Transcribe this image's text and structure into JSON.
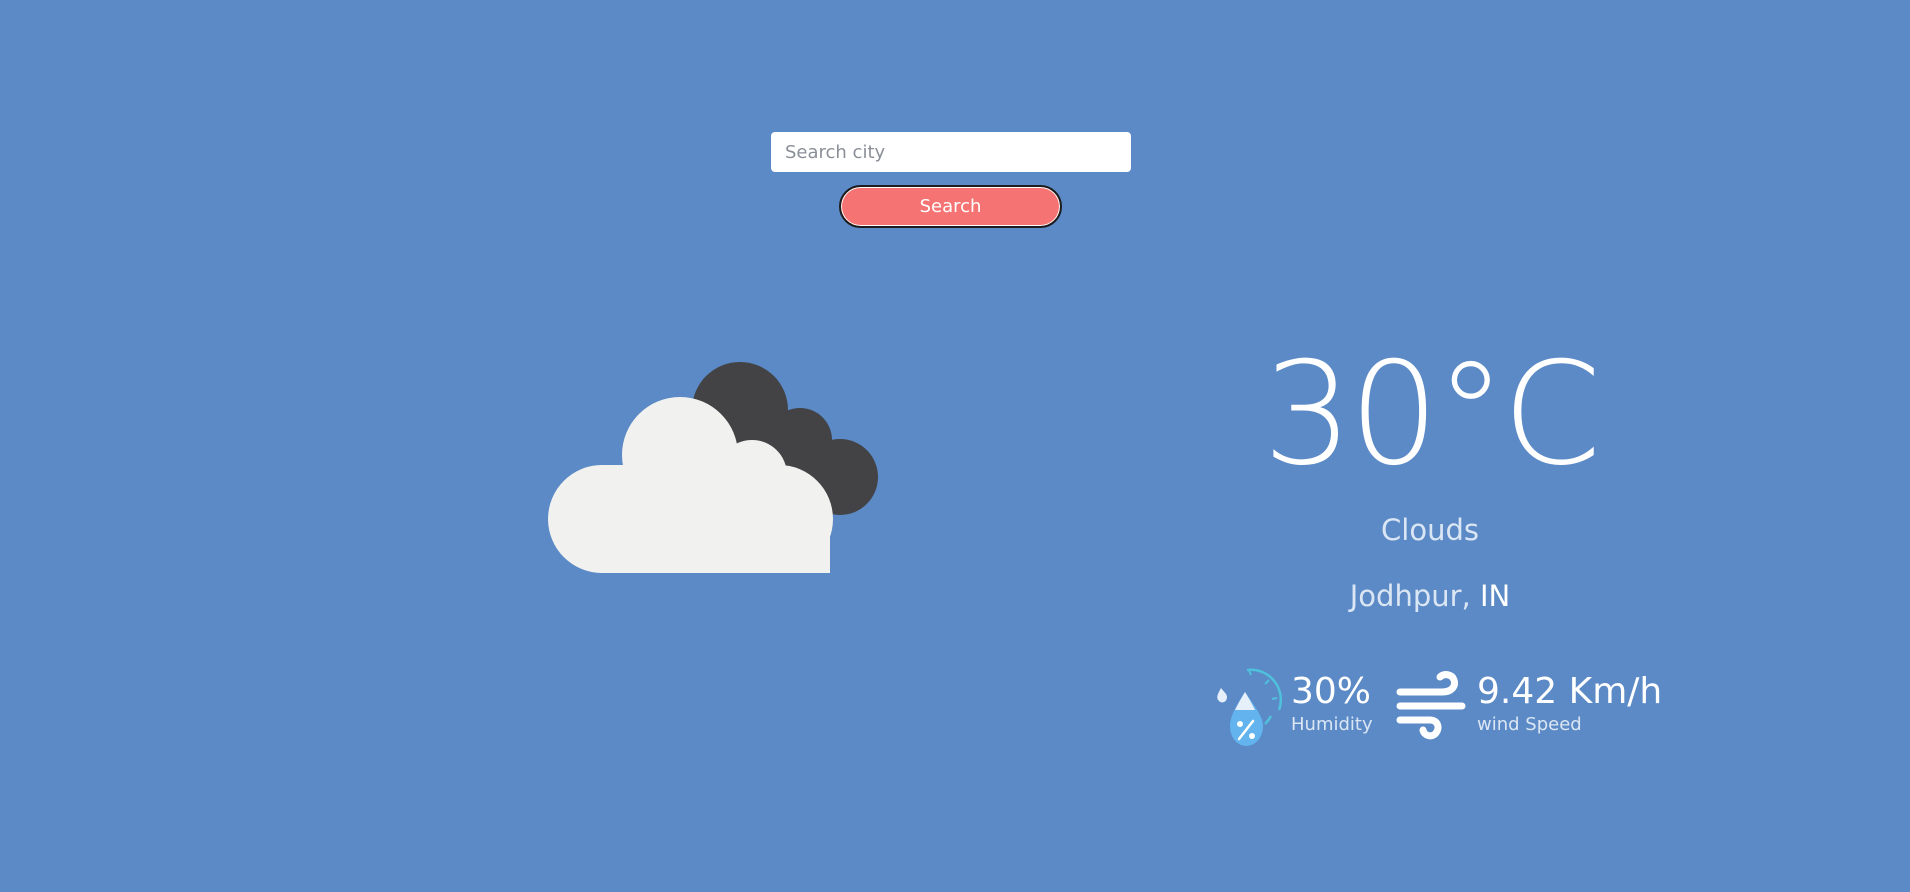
{
  "search": {
    "placeholder": "Search city",
    "value": "",
    "button_label": "Search"
  },
  "current": {
    "icon": "clouds-icon",
    "temperature": "30°C",
    "condition": "Clouds",
    "city": "Jodhpur,",
    "country": "IN"
  },
  "stats": {
    "humidity": {
      "icon": "humidity-icon",
      "value": "30%",
      "label": "Humidity"
    },
    "wind": {
      "icon": "wind-icon",
      "value": "9.42 Km/h",
      "label": "wind Speed"
    }
  },
  "colors": {
    "background": "#5b8ac6",
    "button": "#f57373",
    "cloud_light": "#f1f1ef",
    "cloud_dark": "#434345"
  }
}
